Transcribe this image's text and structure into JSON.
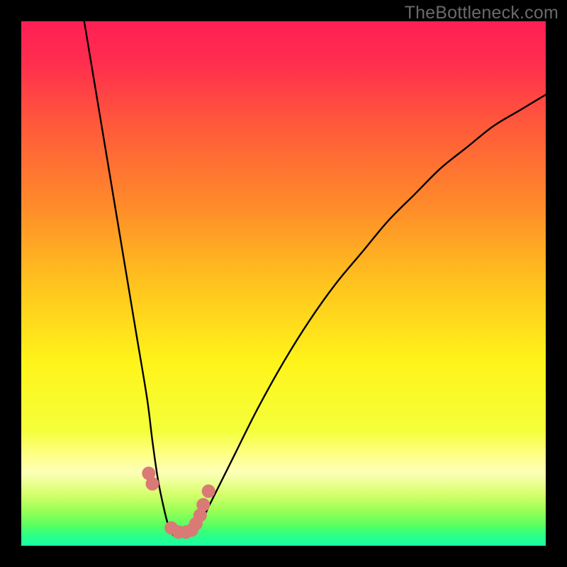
{
  "watermark": "TheBottleneck.com",
  "colors": {
    "black": "#000000",
    "watermark_text": "#6a6a6a",
    "curve_stroke": "#000000",
    "marker_fill": "#d97a77",
    "gradient_stops": [
      {
        "offset": 0.0,
        "color": "#ff1f54"
      },
      {
        "offset": 0.08,
        "color": "#ff2e4e"
      },
      {
        "offset": 0.2,
        "color": "#ff5a3a"
      },
      {
        "offset": 0.35,
        "color": "#ff8a2a"
      },
      {
        "offset": 0.5,
        "color": "#ffc31e"
      },
      {
        "offset": 0.65,
        "color": "#fff41a"
      },
      {
        "offset": 0.78,
        "color": "#f4ff3a"
      },
      {
        "offset": 0.83,
        "color": "#ffff8c"
      },
      {
        "offset": 0.86,
        "color": "#fdffb8"
      },
      {
        "offset": 0.9,
        "color": "#d8ff6e"
      },
      {
        "offset": 0.93,
        "color": "#a0ff55"
      },
      {
        "offset": 0.96,
        "color": "#5cff60"
      },
      {
        "offset": 0.98,
        "color": "#2bff86"
      },
      {
        "offset": 1.0,
        "color": "#18ffa3"
      }
    ]
  },
  "chart_data": {
    "type": "line",
    "title": "",
    "xlabel": "",
    "ylabel": "",
    "xlim": [
      0,
      100
    ],
    "ylim": [
      0,
      100
    ],
    "grid": false,
    "legend": false,
    "series": [
      {
        "name": "bottleneck-curve",
        "x": [
          12,
          14,
          16,
          18,
          20,
          22,
          24,
          25,
          26,
          27,
          28,
          29,
          30,
          32,
          34,
          36,
          40,
          45,
          50,
          55,
          60,
          65,
          70,
          75,
          80,
          85,
          90,
          95,
          100
        ],
        "y": [
          100,
          88,
          76,
          64,
          52,
          40,
          28,
          20,
          13,
          8,
          4,
          2,
          2,
          2,
          4,
          8,
          16,
          26,
          35,
          43,
          50,
          56,
          62,
          67,
          72,
          76,
          80,
          83,
          86
        ]
      }
    ],
    "markers": {
      "name": "highlighted-points",
      "x": [
        24.3,
        25.0,
        28.6,
        30.0,
        31.4,
        32.5,
        33.3,
        34.1,
        34.7,
        35.7
      ],
      "y": [
        13.8,
        11.8,
        3.4,
        2.6,
        2.6,
        3.0,
        4.2,
        5.8,
        7.8,
        10.4
      ]
    }
  }
}
